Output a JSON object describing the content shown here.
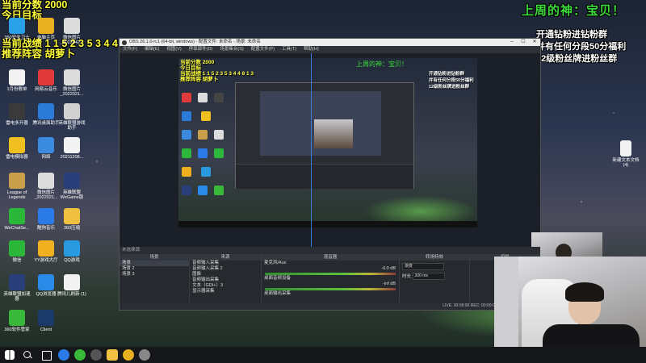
{
  "stream_overlay": {
    "score_line": "当前分数 2000",
    "goal_line": "今日目标",
    "record_line": "当前战绩 1 1 5 2 3 5 3 4 4 8 1 3",
    "lineup_line": "推荐阵容 胡萝卜",
    "god_label": "上周的神：宝贝！",
    "promo_1": "开通钻粉进钻粉群",
    "promo_2": "并有任何分段50分福利",
    "promo_3": "12级粉丝牌进粉丝群"
  },
  "desktop_icons": [
    {
      "label": "360安全卫士",
      "icon": "shield-icon",
      "color": "#2aa0e8"
    },
    {
      "label": "电脑主页",
      "icon": "home-icon",
      "color": "#e8b020"
    },
    {
      "label": "微信图片_2022042...",
      "icon": "image-icon",
      "color": "#dcdcdc"
    },
    {
      "label": "1月份歌单",
      "icon": "document-icon",
      "color": "#f2f2f2"
    },
    {
      "label": "网易云音乐",
      "icon": "music-icon",
      "color": "#e03a3a"
    },
    {
      "label": "微信图片_2022021...",
      "icon": "image-icon",
      "color": "#dcdcdc"
    },
    {
      "label": "雷电多开器",
      "icon": "emulator-icon",
      "color": "#3a3a3a"
    },
    {
      "label": "腾讯桌面助手",
      "icon": "assistant-icon",
      "color": "#2a7ad8"
    },
    {
      "label": "英雄联盟游戏助手",
      "icon": "game-assistant-icon",
      "color": "#d0d0d0"
    },
    {
      "label": "雷电模拟器",
      "icon": "emulator-icon",
      "color": "#f0c020"
    },
    {
      "label": "网络",
      "icon": "network-icon",
      "color": "#3a8ae0"
    },
    {
      "label": "20211208...",
      "icon": "document-icon",
      "color": "#f2f2f2"
    },
    {
      "label": "League of Legends",
      "icon": "lol-icon",
      "color": "#c8a04a"
    },
    {
      "label": "微信图片_2022021...",
      "icon": "image-icon",
      "color": "#dcdcdc"
    },
    {
      "label": "英雄联盟 WeGame版",
      "icon": "lol-icon",
      "color": "#2a3e7a"
    },
    {
      "label": "WeChatSe...",
      "icon": "wechat-icon",
      "color": "#2bb83a"
    },
    {
      "label": "酷狗音乐",
      "icon": "music-icon",
      "color": "#2a7ae8"
    },
    {
      "label": "360压缩",
      "icon": "folder-icon",
      "color": "#f0c040"
    },
    {
      "label": "微信",
      "icon": "wechat-icon",
      "color": "#2bb83a"
    },
    {
      "label": "YY游戏大厅",
      "icon": "yy-icon",
      "color": "#f0b020"
    },
    {
      "label": "QQ游戏",
      "icon": "qq-icon",
      "color": "#2a9ae0"
    },
    {
      "label": "英雄联盟加速器",
      "icon": "lol-icon",
      "color": "#2a3e7a"
    },
    {
      "label": "QQ浏览器",
      "icon": "browser-icon",
      "color": "#2a8ae8"
    },
    {
      "label": "腾讯儿刷新 (1)",
      "icon": "document-icon",
      "color": "#f2f2f2"
    },
    {
      "label": "360软件管家",
      "icon": "store-icon",
      "color": "#3ab83a"
    },
    {
      "label": "Client",
      "icon": "client-icon",
      "color": "#1a3a6a"
    }
  ],
  "right_desktop_icon": {
    "label": "新建文本文档 (4)",
    "icon": "document-icon"
  },
  "obs": {
    "title": "OBS 26.1.0-rc1 (64-bit, windows) - 配置文件: 未命名 - 场景: 未命名",
    "menu": [
      "文件(F)",
      "编辑(E)",
      "视图(V)",
      "停靠部件(D)",
      "场景集合(S)",
      "配置文件(P)",
      "工具(T)",
      "帮助(H)"
    ],
    "status_label": "未选择源",
    "docks": {
      "scenes_title": "场景",
      "scenes": [
        "场景",
        "场景 2",
        "场景 3"
      ],
      "sources_title": "来源",
      "sources": [
        "音频输入采集",
        "音频输入采集 2",
        "图像",
        "音频输出采集",
        "文本（GDI+）3",
        "显示器采集"
      ],
      "mixer_title": "混音器",
      "mixer_channels": [
        {
          "name": "麦克风/Aux",
          "db": "-0.0 dB"
        },
        {
          "name": "桌面音频设备",
          "db": "-inf dB"
        },
        {
          "name": "桌面输出采集",
          "db": ""
        }
      ],
      "transitions_title": "转场特效",
      "transition_value": "渐变",
      "duration_label": "时长",
      "duration_value": "300 ms",
      "controls_title": "控件"
    },
    "status_bar": "LIVE: 00:00:00   REC: 00:00:00   CPU: 4.3%, 30.00 fps"
  },
  "taskbar": {
    "icons": [
      "windows-icon",
      "search-icon",
      "task-view-icon",
      "edge-icon",
      "360-icon",
      "obs-icon",
      "folder-icon",
      "chrome-icon",
      "gear-icon"
    ]
  }
}
